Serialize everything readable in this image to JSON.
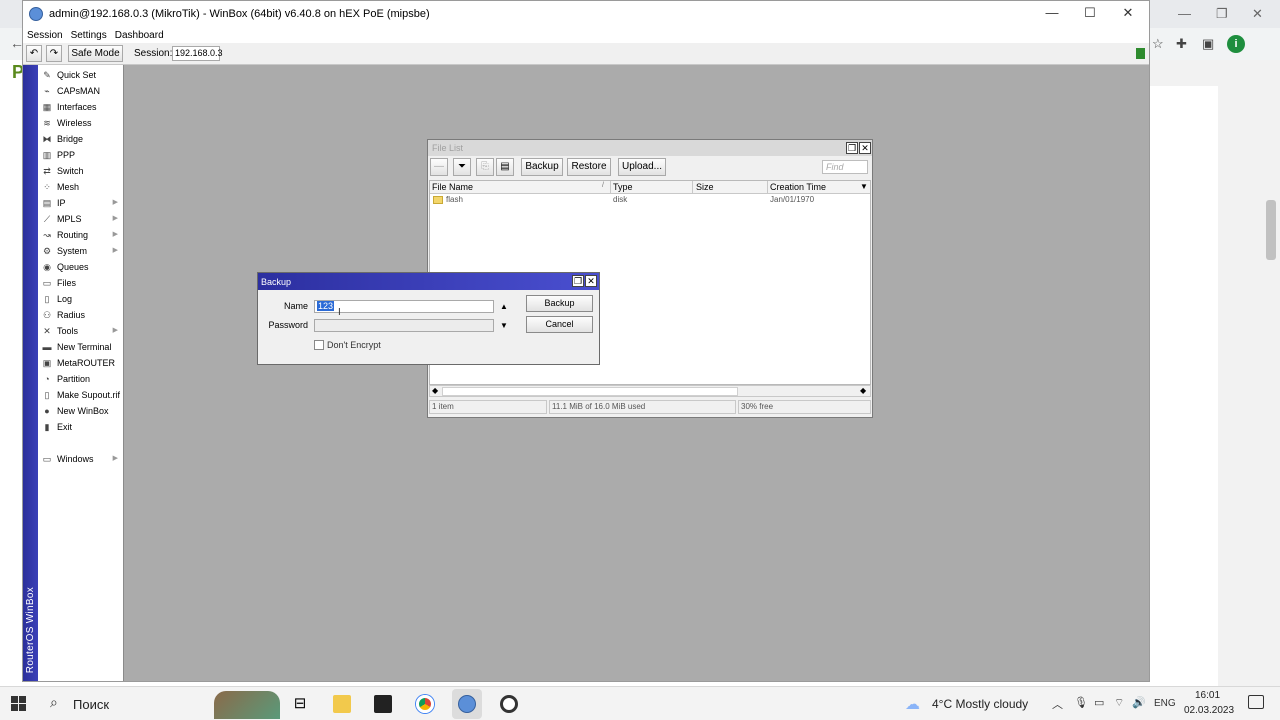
{
  "browser": {
    "back_icon": "arrow-left-icon",
    "page_letter": "P",
    "profile_initial": "i",
    "toolbar_icons": [
      "star-icon",
      "puzzle-icon",
      "sidepanel-icon"
    ]
  },
  "winbox": {
    "title": "admin@192.168.0.3 (MikroTik) - WinBox (64bit) v6.40.8 on hEX PoE (mipsbe)",
    "menu": [
      "Session",
      "Settings",
      "Dashboard"
    ],
    "toolbar": {
      "safe_mode": "Safe Mode",
      "session_label": "Session:",
      "session_value": "192.168.0.3"
    },
    "sidestrip_text": "RouterOS WinBox",
    "sidebar": [
      {
        "label": "Quick Set",
        "icon": "quickset-icon",
        "submenu": false
      },
      {
        "label": "CAPsMAN",
        "icon": "capsman-icon",
        "submenu": false
      },
      {
        "label": "Interfaces",
        "icon": "interfaces-icon",
        "submenu": false
      },
      {
        "label": "Wireless",
        "icon": "wireless-icon",
        "submenu": false
      },
      {
        "label": "Bridge",
        "icon": "bridge-icon",
        "submenu": false
      },
      {
        "label": "PPP",
        "icon": "ppp-icon",
        "submenu": false
      },
      {
        "label": "Switch",
        "icon": "switch-icon",
        "submenu": false
      },
      {
        "label": "Mesh",
        "icon": "mesh-icon",
        "submenu": false
      },
      {
        "label": "IP",
        "icon": "ip-icon",
        "submenu": true
      },
      {
        "label": "MPLS",
        "icon": "mpls-icon",
        "submenu": true
      },
      {
        "label": "Routing",
        "icon": "routing-icon",
        "submenu": true
      },
      {
        "label": "System",
        "icon": "system-icon",
        "submenu": true
      },
      {
        "label": "Queues",
        "icon": "queues-icon",
        "submenu": false
      },
      {
        "label": "Files",
        "icon": "files-icon",
        "submenu": false
      },
      {
        "label": "Log",
        "icon": "log-icon",
        "submenu": false
      },
      {
        "label": "Radius",
        "icon": "radius-icon",
        "submenu": false
      },
      {
        "label": "Tools",
        "icon": "tools-icon",
        "submenu": true
      },
      {
        "label": "New Terminal",
        "icon": "terminal-icon",
        "submenu": false
      },
      {
        "label": "MetaROUTER",
        "icon": "metarouter-icon",
        "submenu": false
      },
      {
        "label": "Partition",
        "icon": "partition-icon",
        "submenu": false
      },
      {
        "label": "Make Supout.rif",
        "icon": "supout-icon",
        "submenu": false
      },
      {
        "label": "New WinBox",
        "icon": "winbox-icon",
        "submenu": false
      },
      {
        "label": "Exit",
        "icon": "exit-icon",
        "submenu": false
      },
      {
        "label": "Windows",
        "icon": "windows-icon",
        "submenu": true
      }
    ]
  },
  "file_list": {
    "title": "File List",
    "buttons": {
      "backup": "Backup",
      "restore": "Restore",
      "upload": "Upload..."
    },
    "find_placeholder": "Find",
    "columns": [
      "File Name",
      "Type",
      "Size",
      "Creation Time"
    ],
    "rows": [
      {
        "name": "flash",
        "type": "disk",
        "size": "",
        "created": "Jan/01/1970"
      }
    ],
    "status": {
      "count": "1 item",
      "usage": "11.1 MiB of 16.0 MiB used",
      "free": "30% free"
    }
  },
  "backup_dialog": {
    "title": "Backup",
    "name_label": "Name",
    "name_value": "123",
    "password_label": "Password",
    "password_value": "",
    "dont_encrypt_label": "Don't Encrypt",
    "dont_encrypt_checked": false,
    "backup_button": "Backup",
    "cancel_button": "Cancel"
  },
  "taskbar": {
    "search_label": "Поиск",
    "weather": "4°C  Mostly cloudy",
    "language": "ENG",
    "time": "16:01",
    "date": "02.03.2023"
  },
  "colors": {
    "winbox_workarea": "#ababab",
    "sidestrip": "#2b2f9a",
    "dialog_title": "#2c2fa0",
    "selection": "#2a6ad6"
  }
}
